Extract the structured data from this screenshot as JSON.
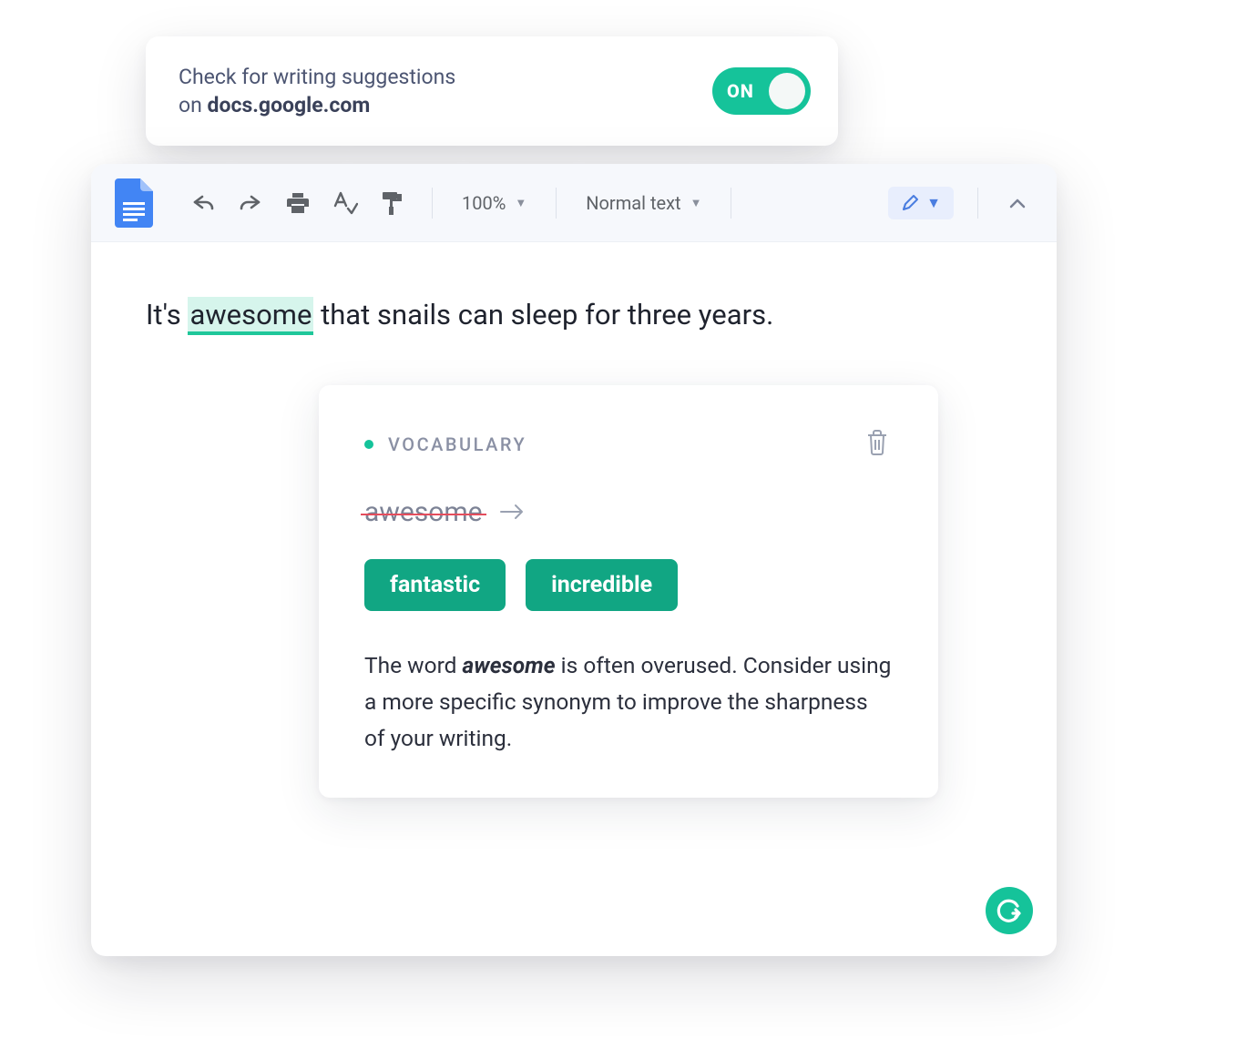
{
  "settings": {
    "line1": "Check for writing suggestions",
    "prefix": "on ",
    "domain": "docs.google.com",
    "toggle_label": "ON",
    "toggle_on": true
  },
  "toolbar": {
    "zoom": "100%",
    "style": "Normal text"
  },
  "document": {
    "prefix": "It's ",
    "highlighted": "awesome",
    "suffix": " that snails can sleep for three years."
  },
  "suggestion": {
    "category": "VOCABULARY",
    "original_word": "awesome",
    "replacements": [
      "fantastic",
      "incredible"
    ],
    "explanation_pre": "The word ",
    "explanation_bold": "awesome",
    "explanation_post": " is often overused. Consider using a more specific synonym to improve the sharpness of your writing."
  }
}
